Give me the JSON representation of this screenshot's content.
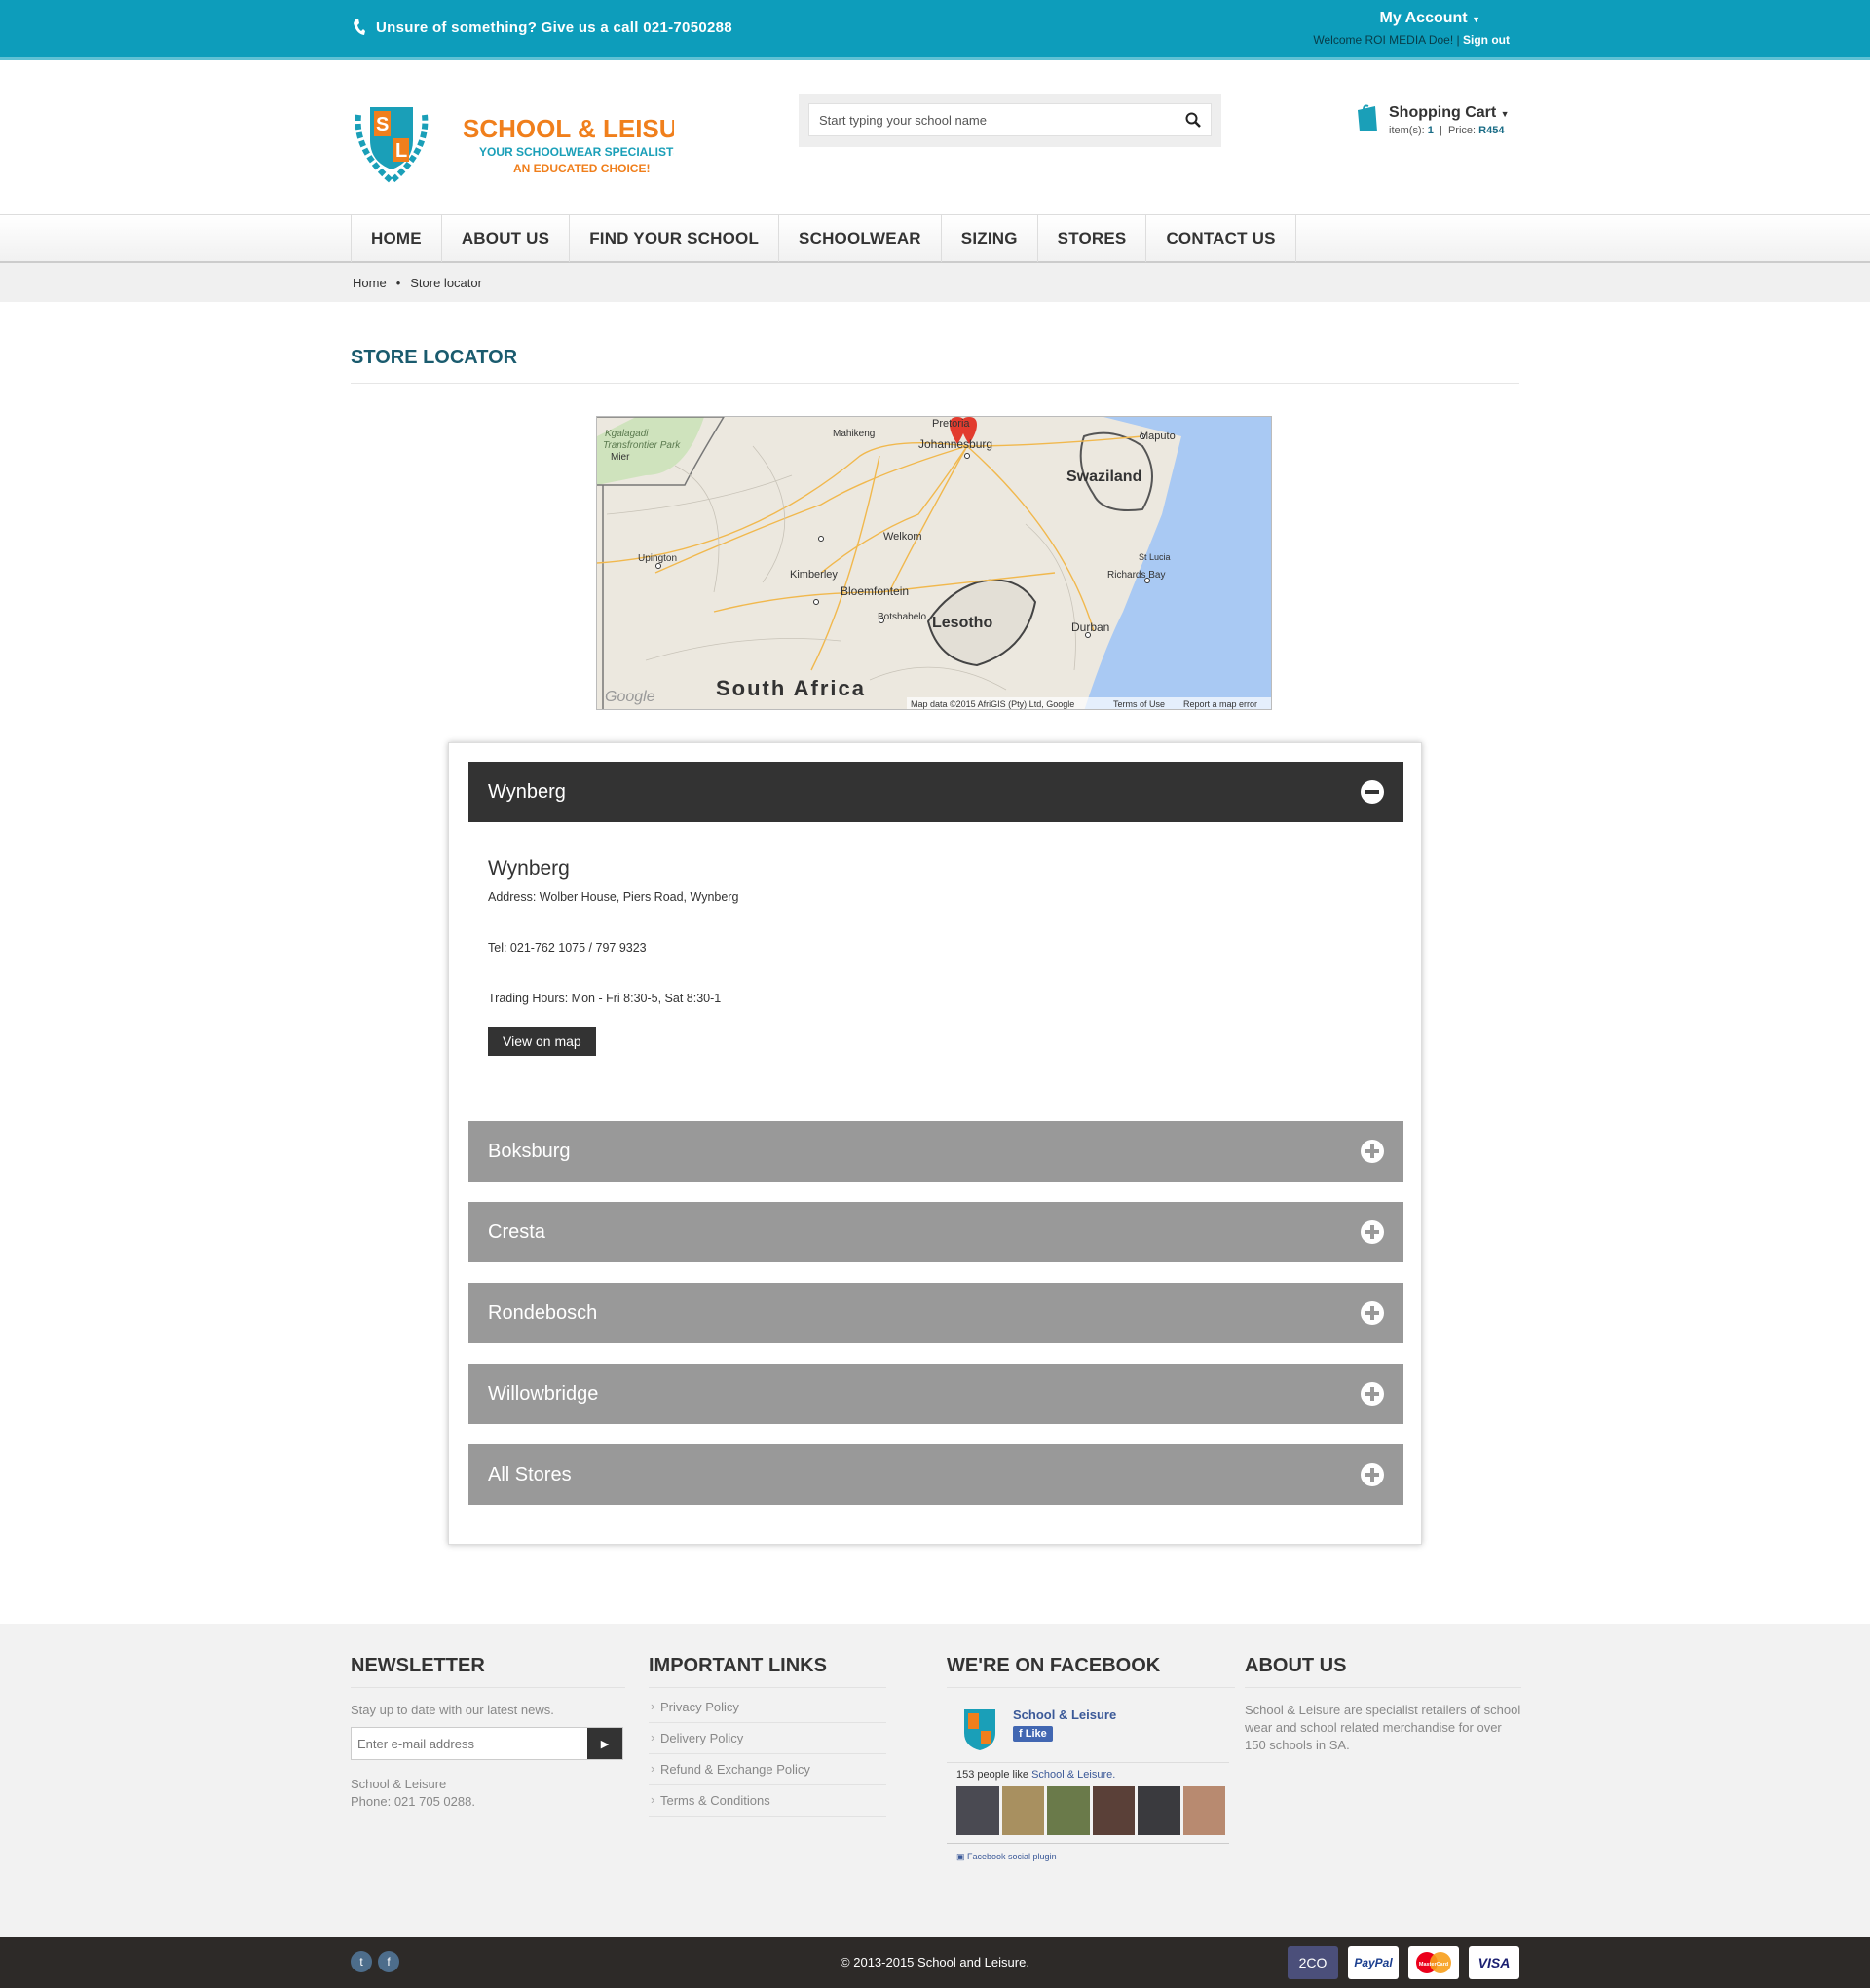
{
  "topbar": {
    "phone_text": "Unsure of something?  Give us a call 021-7050288",
    "account_title": "My Account",
    "welcome": "Welcome ROI MEDIA Doe!",
    "signout": "Sign out"
  },
  "logo": {
    "name": "SCHOOL & LEISURE",
    "tag1": "YOUR SCHOOLWEAR SPECIALISTS",
    "tag2": "AN EDUCATED CHOICE!",
    "initials_s": "S",
    "initials_l": "L"
  },
  "search": {
    "placeholder": "Start typing your school name"
  },
  "cart": {
    "title": "Shopping Cart",
    "items_label": "item(s):",
    "items": "1",
    "price_label": "Price:",
    "price": "R454"
  },
  "nav": {
    "items": [
      "HOME",
      "ABOUT US",
      "FIND YOUR SCHOOL",
      "SCHOOLWEAR",
      "SIZING",
      "STORES",
      "CONTACT US"
    ]
  },
  "breadcrumb": {
    "home": "Home",
    "sep": "•",
    "current": "Store locator"
  },
  "page": {
    "title": "STORE LOCATOR"
  },
  "map": {
    "labels": {
      "south_africa": "South Africa",
      "lesotho": "Lesotho",
      "swaziland": "Swaziland",
      "johannesburg": "Johannesburg",
      "pretoria": "Pretoria",
      "maputo": "Maputo",
      "welkom": "Welkom",
      "kimberley": "Kimberley",
      "bloemfontein": "Bloemfontein",
      "botshabelo": "Botshabelo",
      "upington": "Upington",
      "mahikeng": "Mahikeng",
      "durban": "Durban",
      "richards_bay": "Richards Bay",
      "st_lucia": "St Lucia",
      "kgalagadi": "Kgalagadi",
      "transfrontier": "Transfrontier Park",
      "mier": "Mier",
      "google": "Google"
    },
    "attribution": "Map data ©2015 AfriGIS (Pty) Ltd, Google",
    "terms": "Terms of Use",
    "report": "Report a map error"
  },
  "stores": {
    "open": {
      "name": "Wynberg",
      "heading": "Wynberg",
      "address": "Address: Wolber House, Piers Road, Wynberg",
      "tel": "Tel: 021-762 1075 / 797 9323",
      "hours": "Trading Hours: Mon - Fri 8:30-5, Sat 8:30-1",
      "button": "View on map"
    },
    "closed": [
      "Boksburg",
      "Cresta",
      "Rondebosch",
      "Willowbridge",
      "All Stores"
    ]
  },
  "footer": {
    "newsletter": {
      "title": "NEWSLETTER",
      "text": "Stay up to date with our latest news.",
      "placeholder": "Enter e-mail address",
      "addr1": "School & Leisure",
      "addr2": "Phone: 021 705 0288."
    },
    "links": {
      "title": "IMPORTANT LINKS",
      "items": [
        "Privacy Policy",
        "Delivery Policy",
        "Refund & Exchange Policy",
        "Terms & Conditions"
      ]
    },
    "facebook": {
      "title": "WE'RE ON FACEBOOK",
      "page": "School & Leisure",
      "like": "Like",
      "count_text": "153 people like",
      "count_link": "School & Leisure.",
      "plugin": "Facebook social plugin"
    },
    "about": {
      "title": "ABOUT US",
      "text": "School & Leisure are specialist retailers of school wear and school related merchandise for over 150 schools in SA."
    }
  },
  "bottom": {
    "copyright": "© 2013-2015 School and Leisure.",
    "payments": [
      "2CO",
      "PayPal",
      "MasterCard",
      "VISA"
    ],
    "social": [
      "twitter",
      "facebook"
    ]
  },
  "colors": {
    "teal": "#0d9dbb",
    "dark": "#333333",
    "grey": "#999999",
    "orange": "#f07f1c",
    "title_teal": "#1a5b6e"
  }
}
